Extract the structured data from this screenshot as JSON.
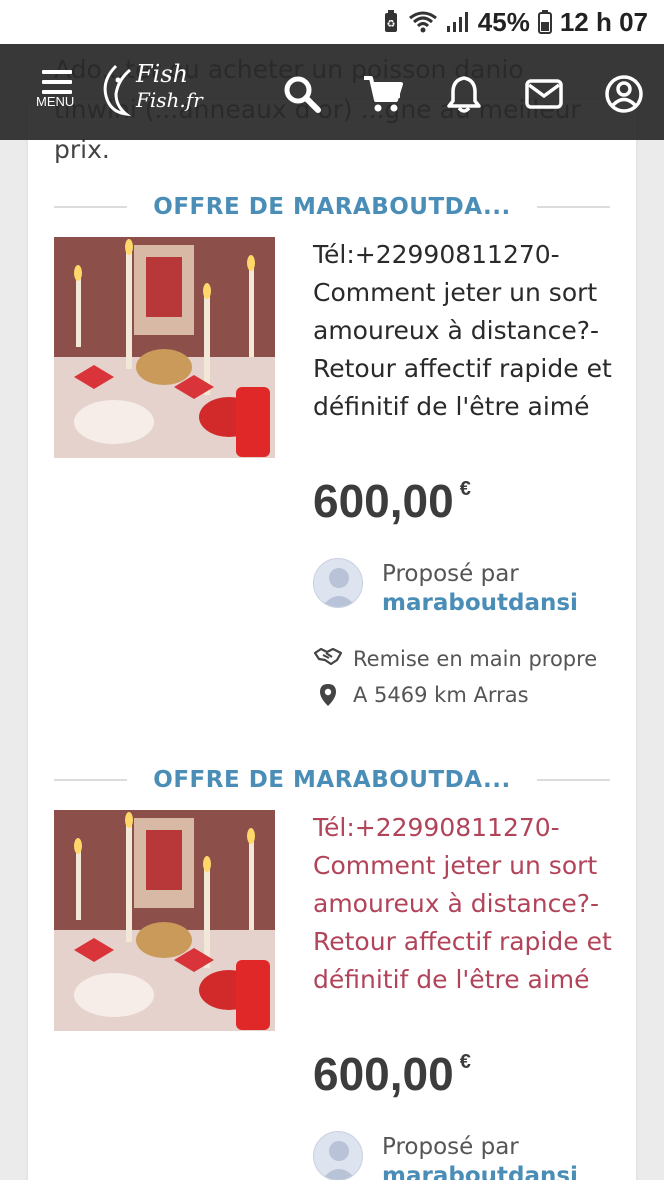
{
  "status_bar": {
    "battery": "45%",
    "time": "12 h 07"
  },
  "nav": {
    "menu_label": "MENU",
    "logo_line1": "Fish",
    "logo_line2": "Fish.fr"
  },
  "background_text": "Ado...ter ou acheter un poisson danio tinwini (...anneaux d'or) ...gne au meilleur prix.",
  "listings": [
    {
      "section_title": "OFFRE DE MARABOUTDA...",
      "title": "Tél:+22990811270- Comment jeter un sort amoureux à distance?- Retour affectif rapide et définitif de l'être aimé",
      "price": "600,00",
      "currency": "€",
      "proposed_by_label": "Proposé par",
      "seller": "maraboutdansi",
      "delivery": "Remise en main propre",
      "location": "A 5469 km Arras"
    },
    {
      "section_title": "OFFRE DE MARABOUTDA...",
      "title": "Tél:+22990811270- Comment jeter un sort amoureux à distance?- Retour affectif rapide et définitif de l'être aimé",
      "price": "600,00",
      "currency": "€",
      "proposed_by_label": "Proposé par",
      "seller": "maraboutdansi"
    }
  ]
}
